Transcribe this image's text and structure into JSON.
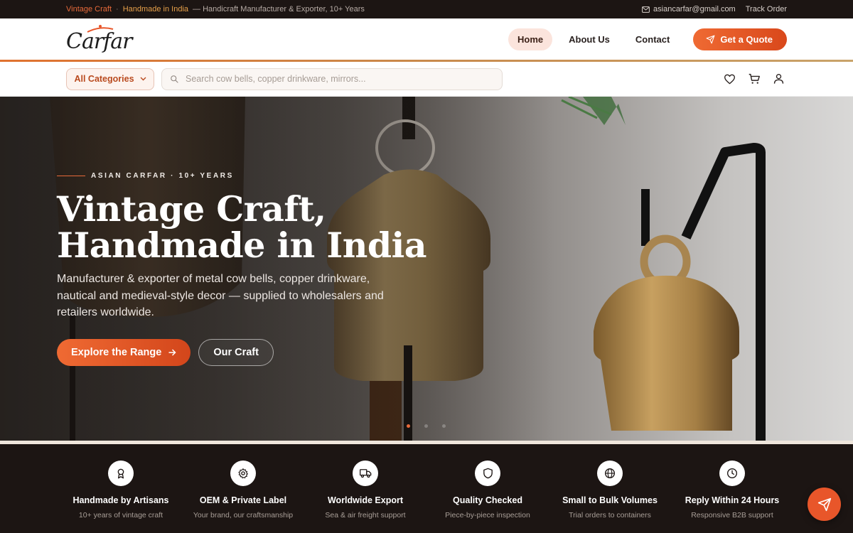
{
  "topbar": {
    "brand": "Vintage Craft",
    "tagline_accent": "Handmade in India",
    "tagline_rest": "— Handicraft Manufacturer & Exporter, 10+ Years",
    "separator": "·",
    "email": "asiancarfar@gmail.com",
    "track_order": "Track Order"
  },
  "header": {
    "logo_text": "Carfar",
    "nav": [
      {
        "label": "Home",
        "active": true
      },
      {
        "label": "About Us",
        "active": false
      },
      {
        "label": "Contact",
        "active": false
      }
    ],
    "cta": "Get a Quote"
  },
  "search": {
    "category_label": "All Categories",
    "placeholder": "Search cow bells, copper drinkware, mirrors..."
  },
  "hero": {
    "eyebrow": "ASIAN CARFAR · 10+ YEARS",
    "title_line1": "Vintage Craft,",
    "title_line2": "Handmade in India",
    "subtitle": "Manufacturer & exporter of metal cow bells, copper drinkware, nautical and medieval-style decor — supplied to wholesalers and retailers worldwide.",
    "primary_button": "Explore the Range",
    "secondary_button": "Our Craft",
    "slide_count": 3,
    "active_slide": 1
  },
  "features": [
    {
      "icon": "award-icon",
      "title": "Handmade by Artisans",
      "subtitle": "10+ years of vintage craft"
    },
    {
      "icon": "gear-icon",
      "title": "OEM & Private Label",
      "subtitle": "Your brand, our craftsmanship"
    },
    {
      "icon": "truck-icon",
      "title": "Worldwide Export",
      "subtitle": "Sea & air freight support"
    },
    {
      "icon": "shield-icon",
      "title": "Quality Checked",
      "subtitle": "Piece-by-piece inspection"
    },
    {
      "icon": "globe-icon",
      "title": "Small to Bulk Volumes",
      "subtitle": "Trial orders to containers"
    },
    {
      "icon": "clock-icon",
      "title": "Reply Within 24 Hours",
      "subtitle": "Responsive B2B support"
    }
  ],
  "colors": {
    "accent": "#e8562a",
    "dark": "#1c1513",
    "gold": "#e6a04a"
  }
}
